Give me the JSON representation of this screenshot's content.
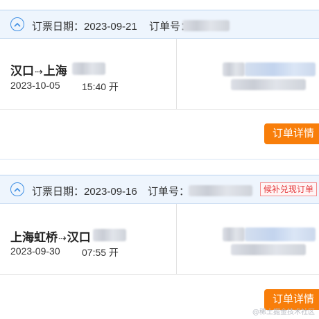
{
  "orders": [
    {
      "header": {
        "date_label": "订票日期：2023-09-21",
        "order_no_label": "订单号："
      },
      "route": {
        "from": "汉口",
        "arrow": "⇢",
        "to": "上海"
      },
      "departure": {
        "date": "2023-10-05",
        "time": "15:40 开"
      },
      "detail_button": "订单详情"
    },
    {
      "header": {
        "date_label": "订票日期：2023-09-16",
        "order_no_label": "订单号：",
        "badge": "候补兑现订单"
      },
      "route": {
        "from": "上海虹桥",
        "arrow": "⇢",
        "to": "汉口"
      },
      "departure": {
        "date": "2023-09-30",
        "time": "07:55 开"
      },
      "detail_button": "订单详情"
    }
  ],
  "watermark": "@稀土掘金技术社区",
  "colors": {
    "accent_blue": "#3d8ee3",
    "header_bg": "#eef5fd",
    "button_orange": "#f87e0a",
    "badge_red": "#e4393c"
  },
  "icons": {
    "collapse": "chevron-up-circle-icon"
  }
}
